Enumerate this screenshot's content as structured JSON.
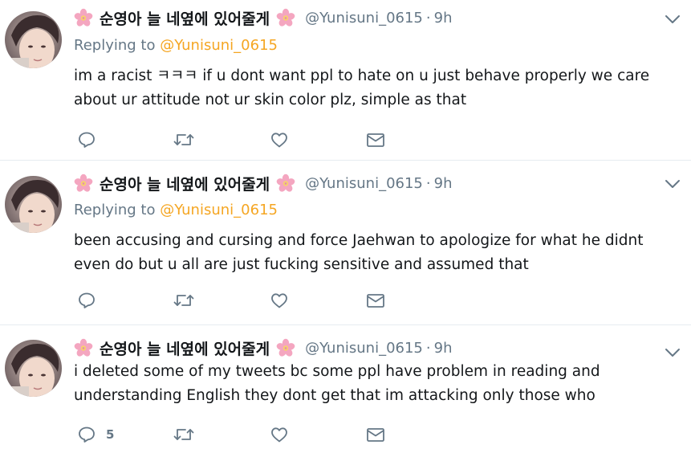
{
  "tweets": [
    {
      "name": "순영아 늘 네옆에 있어줄게",
      "handle": "@Yunisuni_0615",
      "separator": "·",
      "time": "9h",
      "replying_prefix": "Replying to",
      "replying_handle": "@Yunisuni_0615",
      "text": "im a racist ㅋㅋㅋ if u dont want ppl to hate on u just behave properly we care about ur attitude not ur skin color plz, simple as that",
      "reply_count": ""
    },
    {
      "name": "순영아 늘 네옆에 있어줄게",
      "handle": "@Yunisuni_0615",
      "separator": "·",
      "time": "9h",
      "replying_prefix": "Replying to",
      "replying_handle": "@Yunisuni_0615",
      "text": "been accusing and cursing and force Jaehwan to apologize for what he didnt even do but u all are just fucking sensitive and assumed that",
      "reply_count": ""
    },
    {
      "name": "순영아 늘 네옆에 있어줄게",
      "handle": "@Yunisuni_0615",
      "separator": "·",
      "time": "9h",
      "text": "i deleted some of my tweets bc some ppl have problem in reading and understanding English they dont get that im attacking only those who",
      "reply_count": "5"
    }
  ],
  "icons": {
    "flower": "cherry-blossom-icon",
    "caret": "chevron-down-icon",
    "reply": "reply-icon",
    "retweet": "retweet-icon",
    "like": "heart-icon",
    "dm": "envelope-icon"
  },
  "colors": {
    "text": "#14171a",
    "muted": "#657786",
    "reply_handle": "#f5a623",
    "divider": "#e6ecf0"
  }
}
